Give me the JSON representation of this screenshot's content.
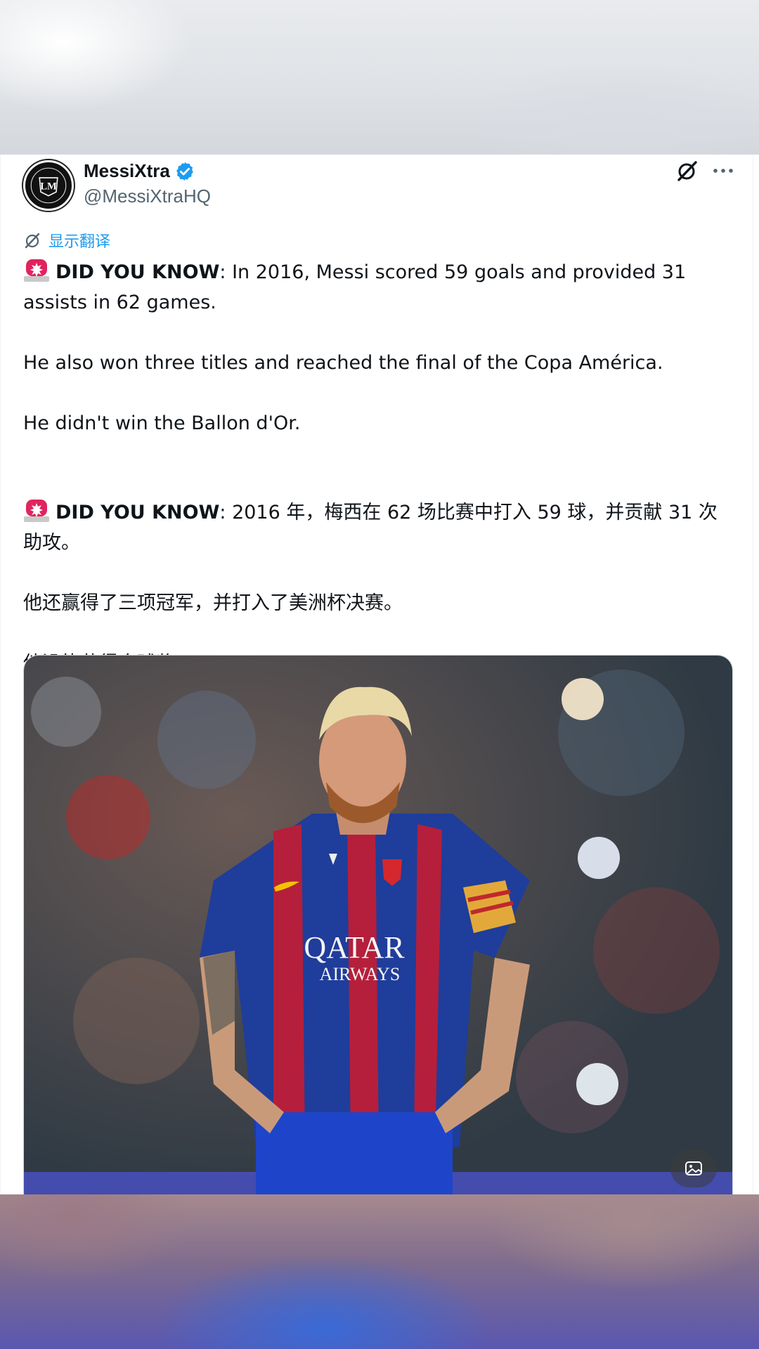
{
  "author": {
    "display_name": "MessiXtra",
    "handle": "@MessiXtraHQ",
    "avatar_text": "LM",
    "verified_color": "#1d9bf0"
  },
  "translate": {
    "label": "显示翻译"
  },
  "post": {
    "original": {
      "lead_bold": "DID YOU KNOW",
      "line1_rest": ": In 2016, Messi scored 59 goals and provided 31 assists in 62 games.",
      "line2": "He also won three titles and reached the final of the Copa América.",
      "line3": "He didn't win the Ballon d'Or."
    },
    "translated": {
      "lead_bold": "DID YOU KNOW",
      "line1_rest": ": 2016 年，梅西在 62 场比赛中打入 59 球，并贡献 31 次助攻。",
      "line2": "他还赢得了三项冠军，并打入了美洲杯决赛。",
      "line3": "他没能获得金球奖。"
    }
  },
  "media": {
    "shirt_text_1": "QATAR",
    "shirt_text_2": "AIRWAYS"
  },
  "icons": {
    "siren": "police-light-emoji",
    "grok": "grok-icon",
    "more": "more-horizontal-icon",
    "alt": "image-description-icon",
    "translate": "translate-icon"
  }
}
